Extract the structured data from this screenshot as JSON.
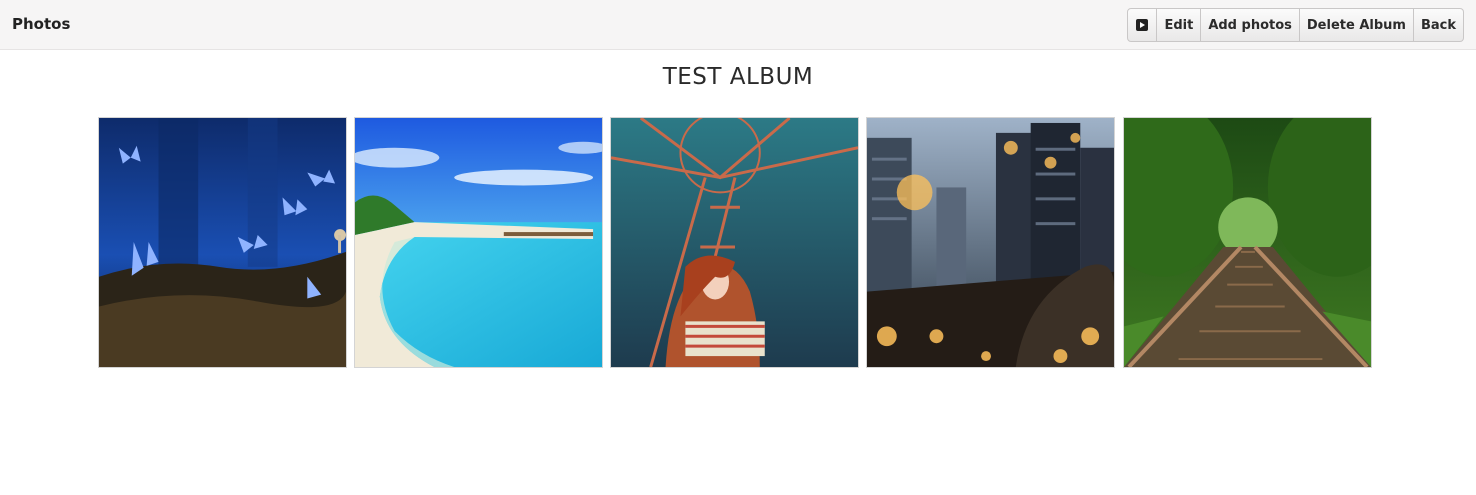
{
  "header": {
    "title": "Photos"
  },
  "toolbar": {
    "slideshow_icon": "play-icon",
    "edit_label": "Edit",
    "add_photos_label": "Add photos",
    "delete_album_label": "Delete Album",
    "back_label": "Back"
  },
  "album": {
    "title": "TEST ALBUM"
  },
  "photos": [
    {
      "subject": "butterflies",
      "accent": "#2f5fc9"
    },
    {
      "subject": "tropical-beach",
      "accent": "#39c6e8"
    },
    {
      "subject": "woman-ferris-wheel",
      "accent": "#2c7b86"
    },
    {
      "subject": "city-lights",
      "accent": "#f0a23a"
    },
    {
      "subject": "railway-forest",
      "accent": "#3f8a2a"
    }
  ]
}
